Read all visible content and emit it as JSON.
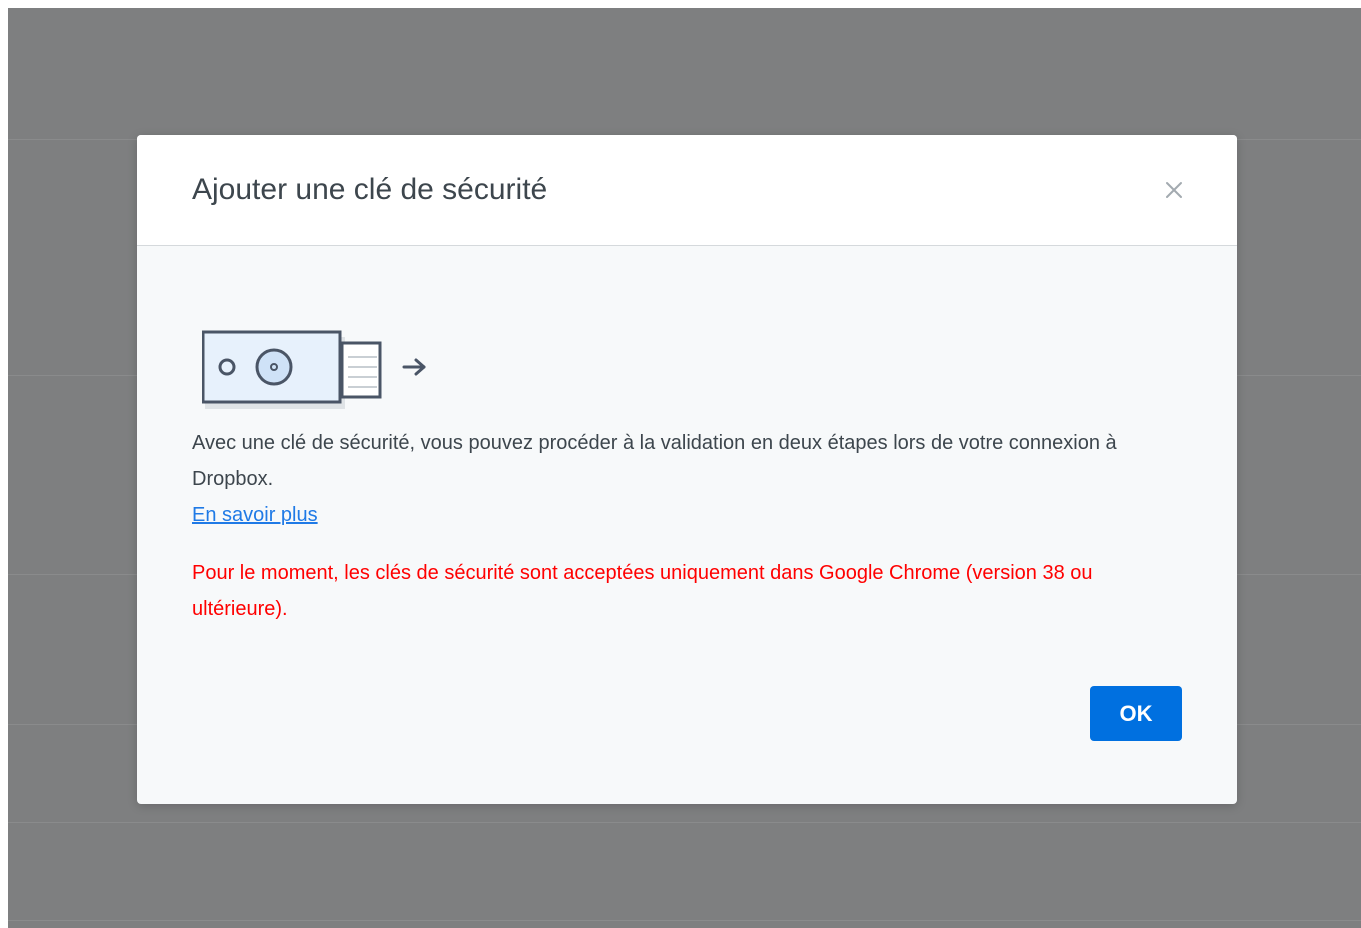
{
  "modal": {
    "title": "Ajouter une clé de sécurité",
    "close_icon": "close-icon",
    "illustration_icon": "security-key-icon",
    "description": "Avec une clé de sécurité, vous pouvez procéder à la validation en deux étapes lors de votre connexion à Dropbox.",
    "learn_more_label": "En savoir plus",
    "warning": "Pour le moment, les clés de sécurité sont acceptées uniquement dans Google Chrome (version 38 ou ultérieure).",
    "ok_label": "OK"
  },
  "colors": {
    "backdrop": "#7e7f80",
    "primary_button": "#0070e0",
    "link": "#1f7ae6",
    "warning_text": "#ff0000",
    "body_text": "#3d464d"
  }
}
